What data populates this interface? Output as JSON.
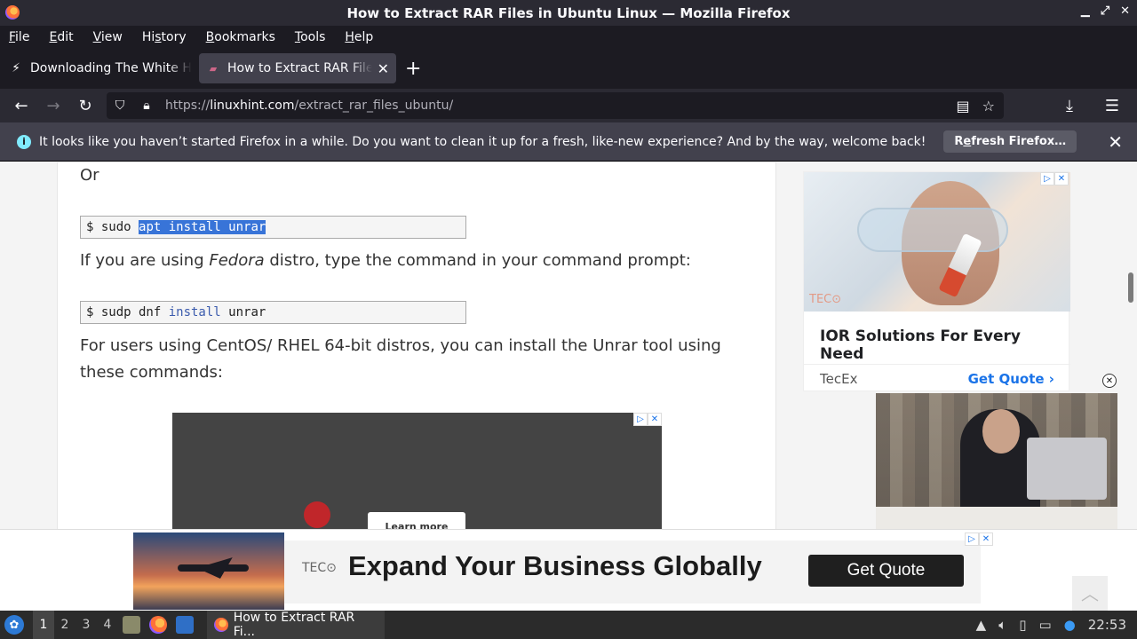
{
  "window": {
    "title": "How to Extract RAR Files in Ubuntu Linux — Mozilla Firefox"
  },
  "menu": [
    {
      "label": "File",
      "ul": "F",
      "rest": "ile"
    },
    {
      "label": "Edit",
      "ul": "E",
      "rest": "dit"
    },
    {
      "label": "View",
      "ul": "V",
      "rest": "iew"
    },
    {
      "label": "History",
      "pre": "Hi",
      "ul": "s",
      "rest": "tory"
    },
    {
      "label": "Bookmarks",
      "ul": "B",
      "rest": "ookmarks"
    },
    {
      "label": "Tools",
      "ul": "T",
      "rest": "ools"
    },
    {
      "label": "Help",
      "ul": "H",
      "rest": "elp"
    }
  ],
  "tabs": [
    {
      "title": "Downloading The White House",
      "active": false
    },
    {
      "title": "How to Extract RAR Files in Ubuntu",
      "active": true
    }
  ],
  "url": {
    "prefix": "https://",
    "host": "linuxhint.com",
    "path": "/extract_rar_files_ubuntu/"
  },
  "notification": {
    "message": "It looks like you haven’t started Firefox in a while. Do you want to clean it up for a fresh, like-new experience? And by the way, welcome back!",
    "button_pre": "R",
    "button_ul": "e",
    "button_rest": "fresh Firefox…"
  },
  "article": {
    "or": "Or",
    "cmd1": {
      "prompt": "$ sudo ",
      "selected": "apt install unrar"
    },
    "fedora_pre": "If you are using ",
    "fedora_em": "Fedora",
    "fedora_post": " distro, type the command in your command prompt:",
    "cmd2": {
      "prompt": "$ sudp dnf ",
      "kw": "install",
      "rest": " unrar"
    },
    "centos_line1": "For users using CentOS/ RHEL 64-bit distros, you can install the Unrar tool using",
    "centos_line2": "these commands:",
    "inline_ad_button": "Learn more"
  },
  "side_ad": {
    "headline": "IOR Solutions For Every Need",
    "brand": "TecEx",
    "cta": "Get Quote ›",
    "logo": "TEC⊙"
  },
  "banner_ad": {
    "logo": "TEC⊙",
    "headline": "Expand Your Business Globally",
    "cta": "Get Quote"
  },
  "taskbar": {
    "workspaces": [
      "1",
      "2",
      "3",
      "4"
    ],
    "task_title": "How to Extract RAR Fi...",
    "clock": "22:53"
  }
}
